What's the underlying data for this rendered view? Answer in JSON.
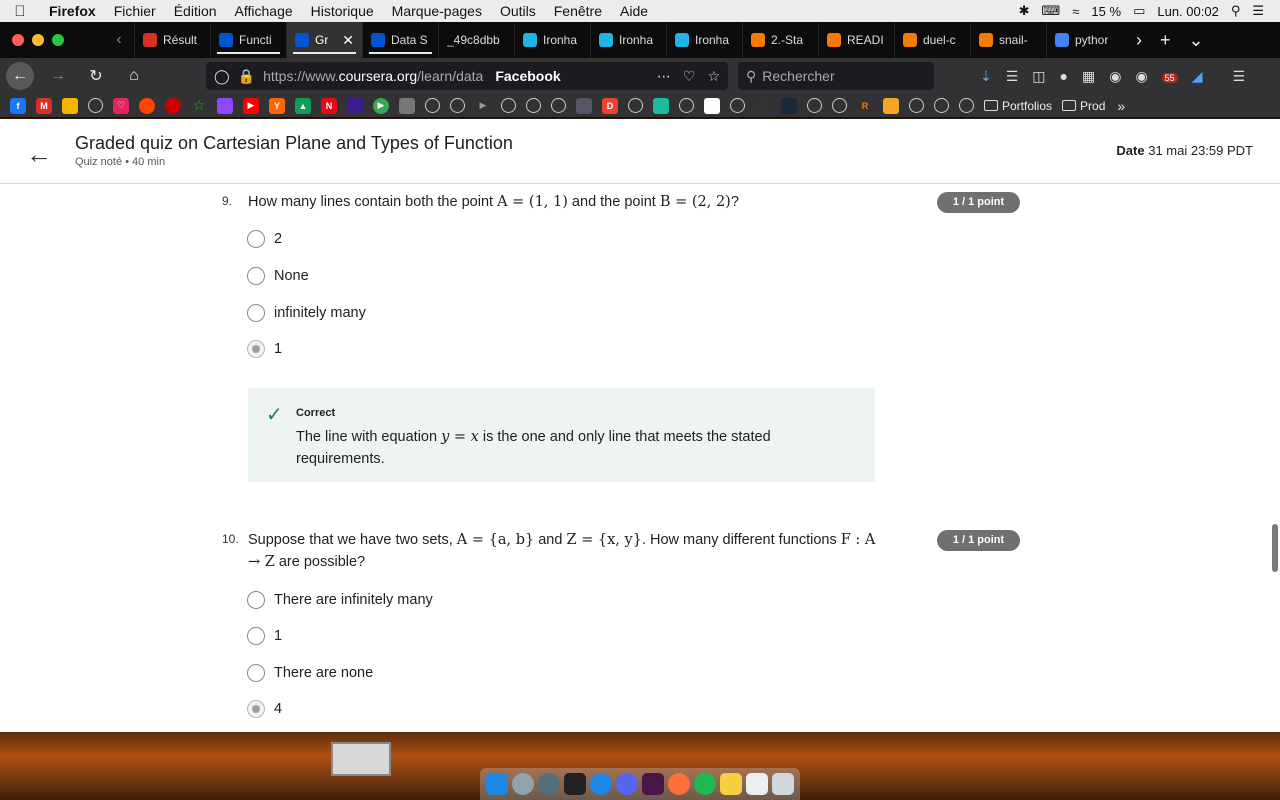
{
  "menubar": {
    "apple": "",
    "items": [
      "Firefox",
      "Fichier",
      "Édition",
      "Affichage",
      "Historique",
      "Marque-pages",
      "Outils",
      "Fenêtre",
      "Aide"
    ],
    "battery": "15 %",
    "clock": "Lun. 00:02"
  },
  "tabs": [
    {
      "label": "Résult",
      "icon": "gmail-icon",
      "color": "#d93025"
    },
    {
      "label": "Functi",
      "icon": "coursera-icon",
      "color": "#0056d2"
    },
    {
      "label": "Gr",
      "icon": "coursera-icon",
      "color": "#0056d2"
    },
    {
      "label": "Data S",
      "icon": "coursera-icon",
      "color": "#0056d2"
    },
    {
      "label": "_49c8dbb",
      "icon": "none",
      "color": "#0c0c0d"
    },
    {
      "label": "Ironha",
      "icon": "ironhack-icon",
      "color": "#1fb2e4"
    },
    {
      "label": "Ironha",
      "icon": "ironhack-icon",
      "color": "#1fb2e4"
    },
    {
      "label": "Ironha",
      "icon": "ironhack-icon",
      "color": "#1fb2e4"
    },
    {
      "label": "2.-Sta",
      "icon": "refresh-icon",
      "color": "#f57c00"
    },
    {
      "label": "READI",
      "icon": "doc-icon",
      "color": "#f57c00"
    },
    {
      "label": "duel-c",
      "icon": "book-icon",
      "color": "#f57c00"
    },
    {
      "label": "snail-",
      "icon": "book-icon",
      "color": "#f57c00"
    },
    {
      "label": "pythor",
      "icon": "google-icon",
      "color": "#4285f4"
    }
  ],
  "nav": {
    "url_prefix": "https://www.",
    "url_domain": "coursera.org",
    "url_path": "/learn/data",
    "facebook": "Facebook",
    "search_placeholder": "Rechercher",
    "badge": "55"
  },
  "bookmarks": {
    "folders": [
      "Portfolios",
      "Prod"
    ]
  },
  "quiz": {
    "title": "Graded quiz on Cartesian Plane and Types of Function",
    "subtitle": "Quiz noté • 40  min",
    "date_label": "Date",
    "date_value": "31 mai 23:59 PDT"
  },
  "q9": {
    "number": "9.",
    "text_a": "How many lines contain both the point ",
    "math_a": "A = (1, 1)",
    "text_b": " and the point ",
    "math_b": "B = (2, 2)",
    "text_c": "?",
    "points": "1 / 1 point",
    "options": [
      "2",
      "None",
      "infinitely many",
      "1"
    ],
    "selected_index": 3,
    "feedback_title": "Correct",
    "feedback_a": "The line with equation ",
    "feedback_math": "y = x",
    "feedback_b": " is the one and only line that meets the stated requirements."
  },
  "q10": {
    "number": "10.",
    "text_a": "Suppose that we have two sets, ",
    "math_a": "A = {a, b}",
    "text_b": " and ",
    "math_b": "Z = {x, y}",
    "text_c": ". How many different functions ",
    "math_c": "F : A → Z",
    "text_d": " are possible?",
    "points": "1 / 1 point",
    "options": [
      "There are infinitely many",
      "1",
      "There are none",
      "4"
    ],
    "selected_index": 3
  }
}
